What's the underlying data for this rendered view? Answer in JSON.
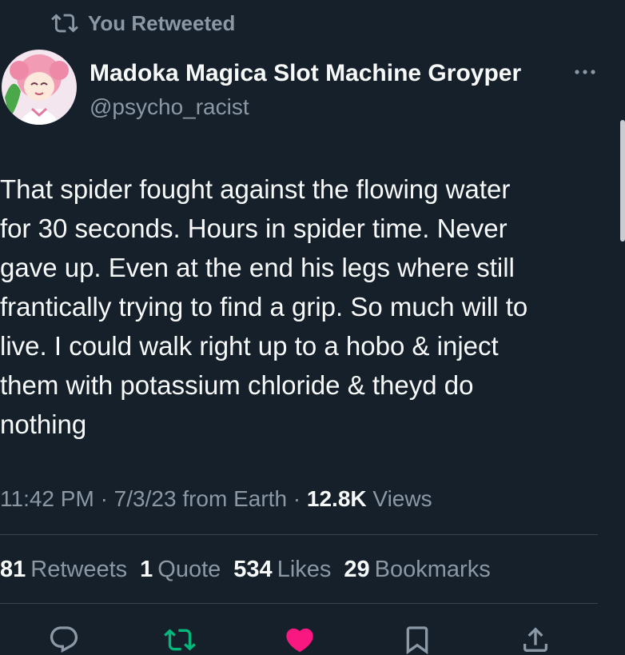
{
  "retweet_banner": {
    "label": "You Retweeted"
  },
  "author": {
    "display_name": "Madoka Magica Slot Machine Groyper",
    "handle": "@psycho_racist"
  },
  "tweet": {
    "text": "That spider fought against the flowing water\nfor 30 seconds. Hours in spider time. Never\ngave up. Even at the end his legs where still\nfrantically trying to find a grip. So much will to\nlive. I could walk right up to a hobo & inject\nthem with potassium chloride & theyd do\nnothing"
  },
  "meta": {
    "time": "11:42 PM",
    "separator": "·",
    "date": "7/3/23",
    "source": "from Earth",
    "views_count": "12.8K",
    "views_label": "Views"
  },
  "stats": {
    "retweets": {
      "count": "81",
      "label": "Retweets"
    },
    "quotes": {
      "count": "1",
      "label": "Quote"
    },
    "likes": {
      "count": "534",
      "label": "Likes"
    },
    "bookmarks": {
      "count": "29",
      "label": "Bookmarks"
    }
  },
  "actions": {
    "reply": {
      "icon": "reply-icon",
      "color": "#8b98a5"
    },
    "retweet": {
      "icon": "retweet-icon",
      "color": "#00ba7c",
      "active": true
    },
    "like": {
      "icon": "heart-icon",
      "color": "#f91880",
      "active": true
    },
    "bookmark": {
      "icon": "bookmark-icon",
      "color": "#8b98a5"
    },
    "share": {
      "icon": "share-icon",
      "color": "#8b98a5"
    }
  },
  "colors": {
    "background": "#15202b",
    "primary_text": "#f7f9f9",
    "secondary_text": "#8b98a5",
    "divider": "#38444d"
  }
}
